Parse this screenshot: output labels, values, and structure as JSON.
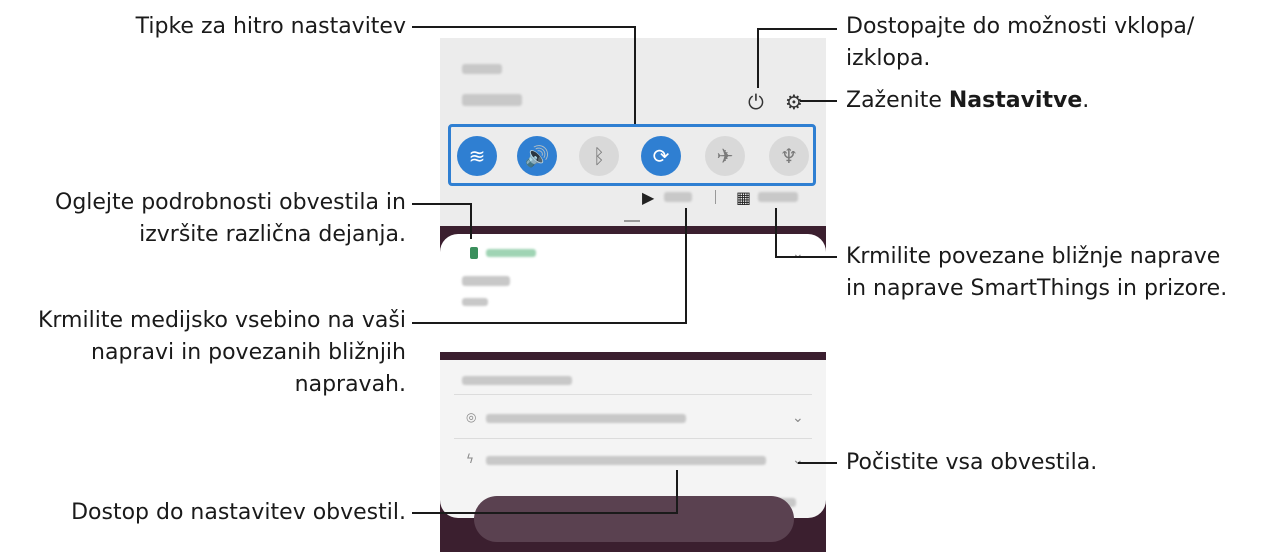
{
  "callouts": {
    "quick_settings": "Tipke za hitro nastavitev",
    "power_line1": "Dostopajte do možnosti vklopa/",
    "power_line2": "izklopa.",
    "settings_prefix": "Zaženite ",
    "settings_bold": "Nastavitve",
    "settings_suffix": ".",
    "notif_details_line1": "Oglejte podrobnosti obvestila in",
    "notif_details_line2": "izvršite različna dejanja.",
    "devices_line1": "Krmilite povezane bližnje naprave",
    "devices_line2": "in naprave SmartThings in prizore.",
    "media_line1": "Krmilite medijsko vsebino na vaši",
    "media_line2": "napravi in povezanih bližnjih",
    "media_line3": "napravah.",
    "clear_all": "Počistite vsa obvestila.",
    "notif_settings": "Dostop do nastavitev obvestil."
  },
  "phone": {
    "quick_buttons": [
      {
        "name": "wifi-icon",
        "glyph": "≋",
        "state": "on"
      },
      {
        "name": "sound-icon",
        "glyph": "🔊",
        "state": "on"
      },
      {
        "name": "bluetooth-icon",
        "glyph": "ᛒ",
        "state": "off"
      },
      {
        "name": "auto-rotate-icon",
        "glyph": "⟳",
        "state": "on"
      },
      {
        "name": "airplane-icon",
        "glyph": "✈",
        "state": "off"
      },
      {
        "name": "flashlight-icon",
        "glyph": "♆",
        "state": "off"
      }
    ],
    "power_glyph": "⏻",
    "settings_glyph": "⚙",
    "media_glyph": "▶",
    "devices_glyph": "▦"
  },
  "colors": {
    "accent": "#2f7fd2",
    "lockscreen": "#3b1f2f"
  }
}
